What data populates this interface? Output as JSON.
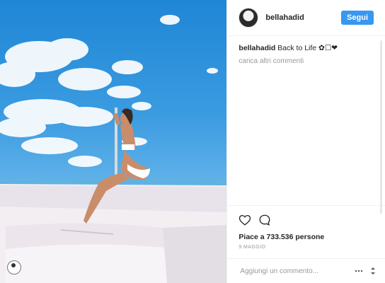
{
  "post": {
    "username": "bellahadid",
    "follow_label": "Segui",
    "caption_user": "bellahadid",
    "caption_text": "Back to Life ✿☐❤",
    "load_more_label": "carica altri commenti",
    "likes_text": "Piace a 733.536 persone",
    "date_text": "9 MAGGIO",
    "comment_placeholder": "Aggiungi un commento..."
  },
  "icons": {
    "like": "heart-icon",
    "comment": "comment-bubble-icon",
    "options": "more-options-icon",
    "tag": "user-tag-icon"
  },
  "colors": {
    "accent": "#3897f0",
    "text": "#262626",
    "muted": "#999999",
    "border": "#efefef"
  }
}
